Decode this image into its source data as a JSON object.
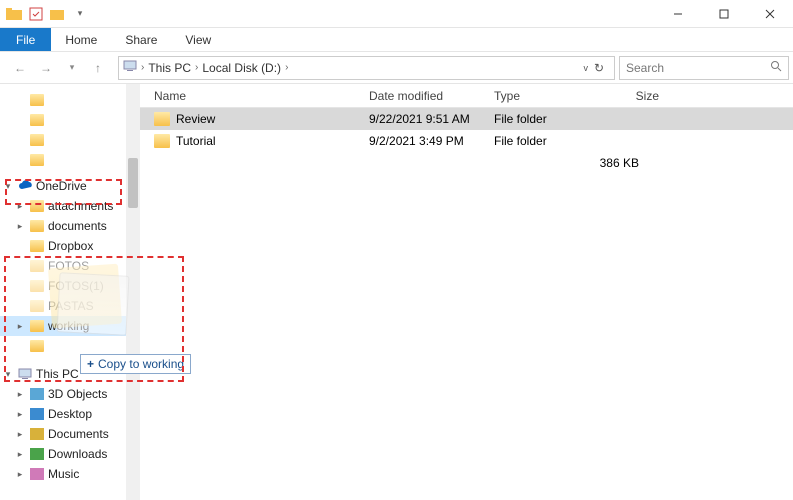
{
  "titlebar": {
    "qat_icons": [
      "folder-icon",
      "properties-icon",
      "new-folder-icon"
    ],
    "window_controls": {
      "minimize": "–",
      "maximize": "▢",
      "close": "✕"
    }
  },
  "ribbon": {
    "file": "File",
    "tabs": [
      "Home",
      "Share",
      "View"
    ]
  },
  "address": {
    "segments": [
      "This PC",
      "Local Disk (D:)"
    ],
    "search_placeholder": "Search"
  },
  "nav": {
    "quick_access_items": [
      "",
      "",
      "",
      "",
      ""
    ],
    "onedrive": {
      "label": "OneDrive",
      "children": [
        {
          "label": "attachments"
        },
        {
          "label": "documents"
        },
        {
          "label": "Dropbox"
        },
        {
          "label": "FOTOS"
        },
        {
          "label": "FOTOS(1)"
        },
        {
          "label": "PASTAS"
        },
        {
          "label": "working",
          "highlight": true
        },
        {
          "label": ""
        }
      ]
    },
    "this_pc": {
      "label": "This PC",
      "children": [
        {
          "label": "3D Objects",
          "icon": "3d"
        },
        {
          "label": "Desktop",
          "icon": "desktop"
        },
        {
          "label": "Documents",
          "icon": "docs"
        },
        {
          "label": "Downloads",
          "icon": "downloads"
        },
        {
          "label": "Music",
          "icon": "music"
        }
      ]
    }
  },
  "list": {
    "headers": {
      "name": "Name",
      "date": "Date modified",
      "type": "Type",
      "size": "Size"
    },
    "rows": [
      {
        "name": "Review",
        "date": "9/22/2021 9:51 AM",
        "type": "File folder",
        "selected": true
      },
      {
        "name": "Tutorial",
        "date": "9/2/2021 3:49 PM",
        "type": "File folder"
      }
    ],
    "status_size": "386 KB"
  },
  "drag": {
    "tooltip_prefix": "+",
    "tooltip_text": "Copy to working"
  }
}
